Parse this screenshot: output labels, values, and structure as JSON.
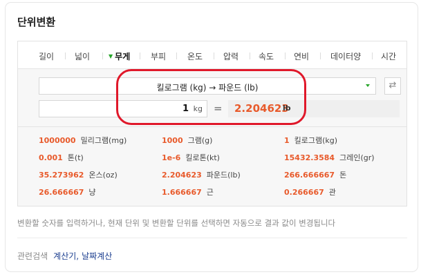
{
  "title": "단위변환",
  "tabs": [
    {
      "label": "길이"
    },
    {
      "label": "넓이"
    },
    {
      "label": "무게",
      "active": true
    },
    {
      "label": "부피"
    },
    {
      "label": "온도"
    },
    {
      "label": "압력"
    },
    {
      "label": "속도"
    },
    {
      "label": "연비"
    },
    {
      "label": "데이터양"
    },
    {
      "label": "시간"
    }
  ],
  "converter": {
    "selected_conversion": "킬로그램 (kg) → 파운드 (lb)",
    "input_value": "1",
    "input_unit": "kg",
    "equals": "=",
    "result_value": "2.204623",
    "result_unit": "lb",
    "swap_icon": "swap-arrows-icon"
  },
  "conversions": [
    {
      "value": "1000000",
      "unit": "밀리그램(mg)"
    },
    {
      "value": "1000",
      "unit": "그램(g)"
    },
    {
      "value": "1",
      "unit": "킬로그램(kg)"
    },
    {
      "value": "0.001",
      "unit": "톤(t)"
    },
    {
      "value": "1e-6",
      "unit": "킬로톤(kt)"
    },
    {
      "value": "15432.3584",
      "unit": "그레인(gr)"
    },
    {
      "value": "35.273962",
      "unit": "온스(oz)"
    },
    {
      "value": "2.204623",
      "unit": "파운드(lb)"
    },
    {
      "value": "266.666667",
      "unit": "돈"
    },
    {
      "value": "26.666667",
      "unit": "냥"
    },
    {
      "value": "1.666667",
      "unit": "근"
    },
    {
      "value": "0.266667",
      "unit": "관"
    }
  ],
  "hint": "변환할 숫자를 입력하거나, 현재 단위 및 변환할 단위를 선택하면 자동으로 결과 값이 변경됩니다",
  "related": {
    "label": "관련검색",
    "links": [
      "계산기,",
      "날짜계산"
    ]
  },
  "colors": {
    "accent": "#e85a2b",
    "highlight": "#e0182a",
    "active_arrow": "#27a52a",
    "link": "#1a3d8f"
  }
}
